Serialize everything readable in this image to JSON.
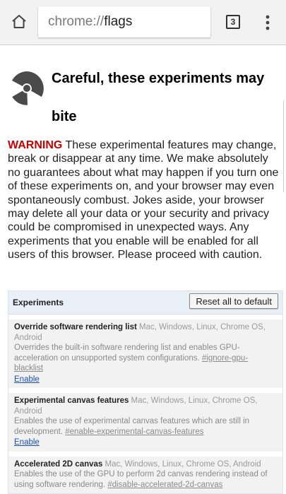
{
  "browser": {
    "url_scheme": "chrome://",
    "url_host": "flags",
    "tab_count": "3"
  },
  "page": {
    "heading": "Careful, these experiments may bite",
    "warning_label": "WARNING",
    "warning_text": " These experimental features may change, break or disappear at any time. We make absolutely no guarantees about what may happen if you turn one of these experiments on, and your browser may even spontaneously combust. Jokes aside, your browser may delete all your data or your security and privacy could be compromised in unexpected ways. Any experiments that you enable will be enabled for all users of this browser. Please proceed with caution."
  },
  "experiments": {
    "title": "Experiments",
    "reset_label": "Reset all to default",
    "items": [
      {
        "name": "Override software rendering list",
        "platforms": " Mac, Windows, Linux, Chrome OS, Android",
        "description": "Overrides the built-in software rendering list and enables GPU-acceleration on unsupported system configurations. ",
        "flag": "#ignore-gpu-blacklist",
        "action": "Enable"
      },
      {
        "name": "Experimental canvas features",
        "platforms": " Mac, Windows, Linux, Chrome OS, Android",
        "description": "Enables the use of experimental canvas features which are still in development. ",
        "flag": "#enable-experimental-canvas-features",
        "action": "Enable"
      },
      {
        "name": "Accelerated 2D canvas",
        "platforms": " Mac, Windows, Linux, Chrome OS, Android",
        "description": "Enables the use of the GPU to perform 2d canvas rendering instead of using software rendering. ",
        "flag": "#disable-accelerated-2d-canvas",
        "action": ""
      }
    ]
  },
  "icons": {
    "home": "home-icon",
    "tabs": "tab-switcher-icon",
    "menu": "overflow-menu-icon",
    "hazard": "radiation-hazard-icon"
  },
  "colors": {
    "toolbar": "#f2f2f2",
    "warning": "#c80000",
    "link": "#1a4fc4",
    "experiments_header": "#eaf0f8"
  }
}
